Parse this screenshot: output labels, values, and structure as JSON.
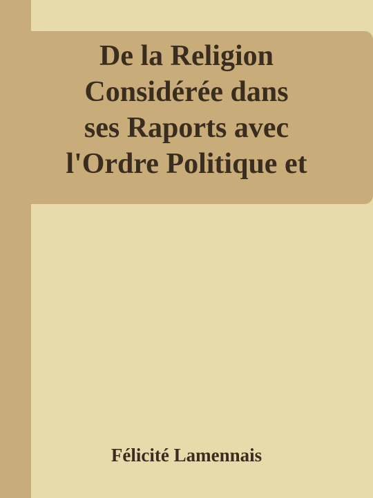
{
  "cover": {
    "title_lines": [
      "De la Religion",
      "Considérée dans",
      "ses Raports avec",
      "l'Ordre Politique et"
    ],
    "author": "Félicité Lamennais"
  },
  "colors": {
    "background": "#e8dbab",
    "band": "#c8ad7a",
    "text": "#3a2d1f"
  }
}
